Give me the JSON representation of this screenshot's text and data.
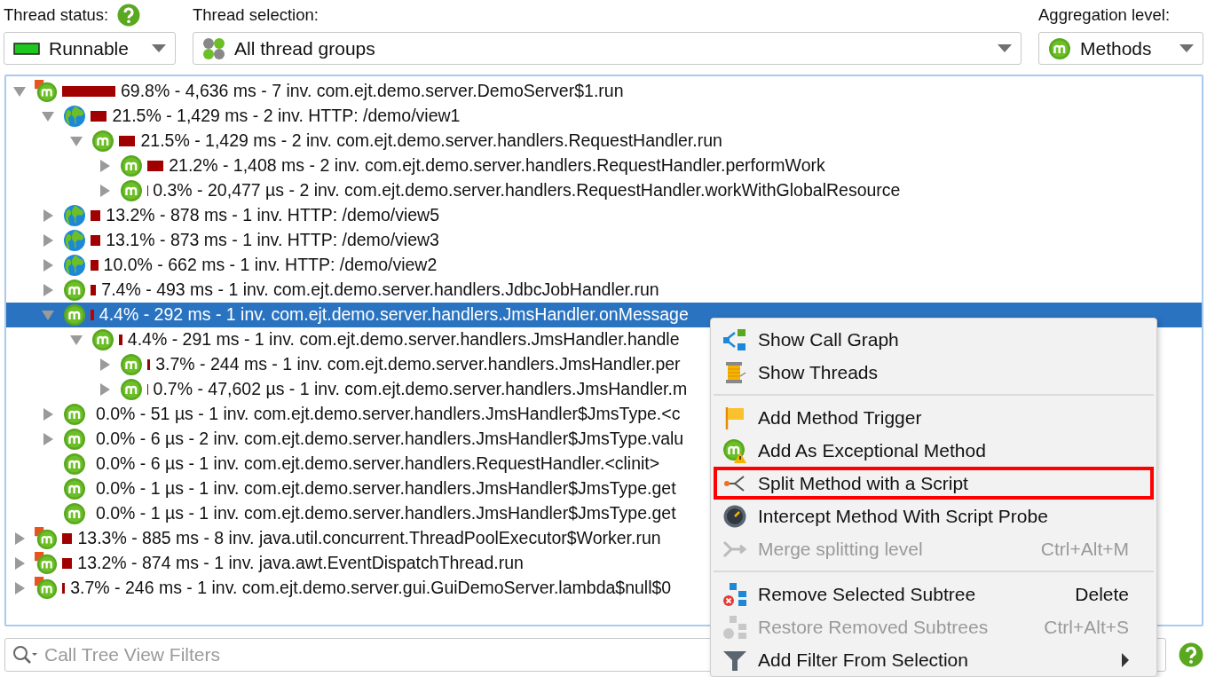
{
  "toolbar": {
    "thread_status": {
      "label": "Thread status:",
      "value": "Runnable"
    },
    "thread_selection": {
      "label": "Thread selection:",
      "value": "All thread groups"
    },
    "aggregation": {
      "label": "Aggregation level:",
      "value": "Methods"
    }
  },
  "call_tree": [
    {
      "kind": "thread",
      "text": "69.8% - 4,636 ms - 7 inv. com.ejt.demo.server.DemoServer$1.run",
      "expanded": true,
      "selected": false,
      "children": [
        {
          "kind": "http",
          "text": "21.5% - 1,429 ms - 2 inv. HTTP: /demo/view1",
          "expanded": true,
          "selected": false,
          "children": [
            {
              "kind": "method",
              "text": "21.5% - 1,429 ms - 2 inv. com.ejt.demo.server.handlers.RequestHandler.run",
              "expanded": true,
              "selected": false,
              "children": [
                {
                  "kind": "method",
                  "text": "21.2% - 1,408 ms - 2 inv. com.ejt.demo.server.handlers.RequestHandler.performWork",
                  "expanded": false,
                  "selected": false
                },
                {
                  "kind": "method",
                  "text": "0.3% - 20,477 µs - 2 inv. com.ejt.demo.server.handlers.RequestHandler.workWithGlobalResource",
                  "expanded": false,
                  "selected": false
                }
              ]
            }
          ]
        },
        {
          "kind": "http",
          "text": "13.2% - 878 ms - 1 inv. HTTP: /demo/view5",
          "expanded": false,
          "selected": false
        },
        {
          "kind": "http",
          "text": "13.1% - 873 ms - 1 inv. HTTP: /demo/view3",
          "expanded": false,
          "selected": false
        },
        {
          "kind": "http",
          "text": "10.0% - 662 ms - 1 inv. HTTP: /demo/view2",
          "expanded": false,
          "selected": false
        },
        {
          "kind": "method",
          "text": "7.4% - 493 ms - 1 inv. com.ejt.demo.server.handlers.JdbcJobHandler.run",
          "expanded": false,
          "selected": false
        },
        {
          "kind": "method",
          "text": "4.4% - 292 ms - 1 inv. com.ejt.demo.server.handlers.JmsHandler.onMessage",
          "expanded": true,
          "selected": true,
          "children": [
            {
              "kind": "method",
              "text": "4.4% - 291 ms - 1 inv. com.ejt.demo.server.handlers.JmsHandler.handle",
              "expanded": true,
              "selected": false,
              "children": [
                {
                  "kind": "method",
                  "text": "3.7% - 244 ms - 1 inv. com.ejt.demo.server.handlers.JmsHandler.per",
                  "expanded": false,
                  "selected": false
                },
                {
                  "kind": "method",
                  "text": "0.7% - 47,602 µs - 1 inv. com.ejt.demo.server.handlers.JmsHandler.m",
                  "expanded": false,
                  "selected": false
                }
              ]
            }
          ]
        },
        {
          "kind": "method",
          "text": "0.0% - 51 µs - 1 inv. com.ejt.demo.server.handlers.JmsHandler$JmsType.<c",
          "expanded": false,
          "selected": false
        },
        {
          "kind": "method",
          "text": "0.0% - 6 µs - 2 inv. com.ejt.demo.server.handlers.JmsHandler$JmsType.valu",
          "expanded": false,
          "selected": false
        },
        {
          "kind": "method",
          "text": "0.0% - 6 µs - 1 inv. com.ejt.demo.server.handlers.RequestHandler.<clinit>",
          "selected": false
        },
        {
          "kind": "method",
          "text": "0.0% - 1 µs - 1 inv. com.ejt.demo.server.handlers.JmsHandler$JmsType.get",
          "selected": false
        },
        {
          "kind": "method",
          "text": "0.0% - 1 µs - 1 inv. com.ejt.demo.server.handlers.JmsHandler$JmsType.get",
          "selected": false
        }
      ]
    },
    {
      "kind": "thread",
      "text": "13.3% - 885 ms - 8 inv. java.util.concurrent.ThreadPoolExecutor$Worker.run",
      "expanded": false,
      "selected": false
    },
    {
      "kind": "thread",
      "text": "13.2% - 874 ms - 1 inv. java.awt.EventDispatchThread.run",
      "expanded": false,
      "selected": false
    },
    {
      "kind": "thread",
      "text": "3.7% - 246 ms - 1 inv. com.ejt.demo.server.gui.GuiDemoServer.lambda$null$0",
      "expanded": false,
      "selected": false
    }
  ],
  "filter": {
    "placeholder": "Call Tree View Filters"
  },
  "context_menu": [
    [
      {
        "kind": "call-graph",
        "label": "Show Call Graph",
        "disabled": false,
        "highlighted": false
      },
      {
        "kind": "threads",
        "label": "Show Threads",
        "disabled": false,
        "highlighted": false
      }
    ],
    [
      {
        "kind": "flag",
        "label": "Add Method Trigger",
        "disabled": false,
        "highlighted": false
      },
      {
        "kind": "exceptional",
        "label": "Add As Exceptional Method",
        "disabled": false,
        "highlighted": false
      },
      {
        "kind": "split",
        "label": "Split Method with a Script",
        "disabled": false,
        "highlighted": true
      },
      {
        "kind": "probe",
        "label": "Intercept Method With Script Probe",
        "disabled": false,
        "highlighted": false
      },
      {
        "kind": "merge",
        "label": "Merge splitting level",
        "shortcut": "Ctrl+Alt+M",
        "disabled": true,
        "highlighted": false
      }
    ],
    [
      {
        "kind": "remove",
        "label": "Remove Selected Subtree",
        "shortcut": "Delete",
        "disabled": false,
        "highlighted": false
      },
      {
        "kind": "restore",
        "label": "Restore Removed Subtrees",
        "shortcut": "Ctrl+Alt+S",
        "disabled": true,
        "highlighted": false
      },
      {
        "kind": "filter",
        "label": "Add Filter From Selection",
        "submenu": true,
        "disabled": false,
        "highlighted": false
      }
    ]
  ]
}
